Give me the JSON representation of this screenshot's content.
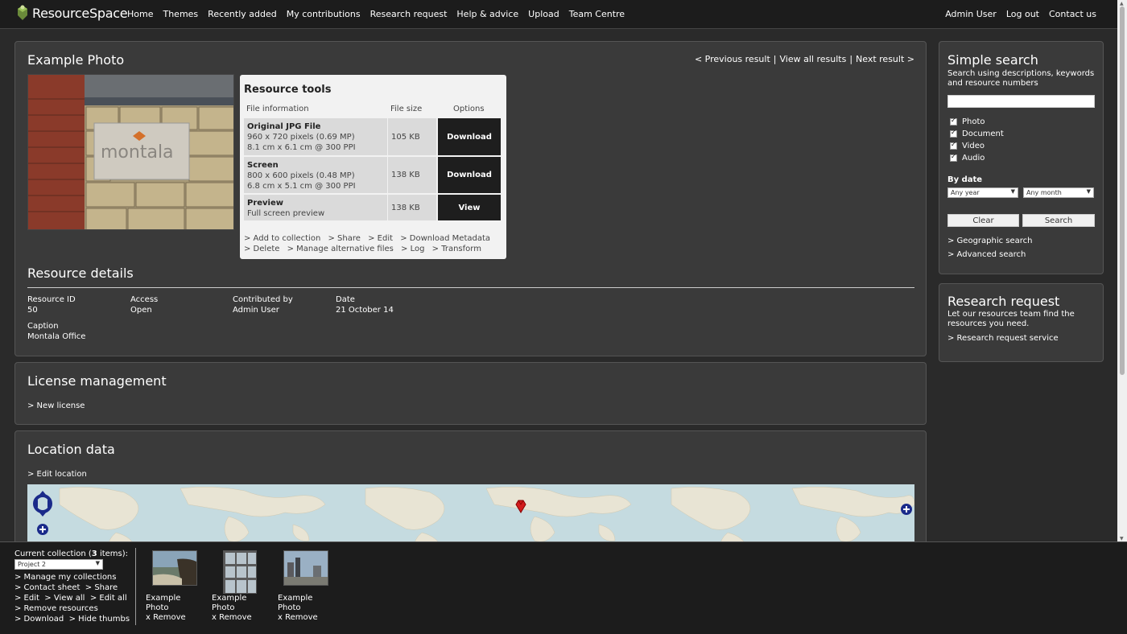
{
  "header": {
    "logo_text": "ResourceSpace",
    "nav": [
      "Home",
      "Themes",
      "Recently added",
      "My contributions",
      "Research request",
      "Help & advice",
      "Upload",
      "Team Centre"
    ],
    "user_nav": [
      "Admin User",
      "Log out",
      "Contact us"
    ]
  },
  "resource": {
    "title": "Example Photo",
    "result_nav": {
      "previous": "< Previous result",
      "view_all": "View all results",
      "next": "Next result >",
      "separator": "|"
    },
    "image_sign_text": "montala",
    "tools": {
      "title": "Resource tools",
      "columns": [
        "File information",
        "File size",
        "Options"
      ],
      "rows": [
        {
          "name": "Original JPG File",
          "line1": "960 x 720 pixels (0.69 MP)",
          "line2": "8.1 cm x 6.1 cm @ 300 PPI",
          "size": "105 KB",
          "action": "Download"
        },
        {
          "name": "Screen",
          "line1": "800 x 600 pixels (0.48 MP)",
          "line2": "6.8 cm x 5.1 cm @ 300 PPI",
          "size": "138 KB",
          "action": "Download"
        },
        {
          "name": "Preview",
          "line1": "Full screen preview",
          "line2": "",
          "size": "138 KB",
          "action": "View"
        }
      ],
      "links_line1": [
        "> Add to collection",
        "> Share",
        "> Edit",
        "> Download Metadata"
      ],
      "links_line2": [
        "> Delete",
        "> Manage alternative files",
        "> Log",
        "> Transform"
      ]
    },
    "details": {
      "title": "Resource details",
      "fields": [
        {
          "label": "Resource ID",
          "value": "50"
        },
        {
          "label": "Access",
          "value": "Open"
        },
        {
          "label": "Contributed by",
          "value": "Admin User"
        },
        {
          "label": "Date",
          "value": "21 October 14"
        },
        {
          "label": "Caption",
          "value": "Montala Office"
        }
      ]
    }
  },
  "license": {
    "title": "License management",
    "new_link": "> New license"
  },
  "location": {
    "title": "Location data",
    "edit_link": "> Edit location"
  },
  "search": {
    "title": "Simple search",
    "description": "Search using descriptions, keywords and resource numbers",
    "input_value": "",
    "filters": [
      "Photo",
      "Document",
      "Video",
      "Audio"
    ],
    "by_date_label": "By date",
    "year_select": "Any year",
    "month_select": "Any month",
    "clear_label": "Clear",
    "search_label": "Search",
    "geo_link": "> Geographic search",
    "advanced_link": "> Advanced search"
  },
  "research": {
    "title": "Research request",
    "description": "Let our resources team find the resources you need.",
    "link": "> Research request service"
  },
  "collection": {
    "label_prefix": "Current collection (",
    "count": "3",
    "label_suffix": " items):",
    "selected": "Project 2",
    "links": [
      [
        "> Manage my collections"
      ],
      [
        "> Contact sheet",
        "> Share"
      ],
      [
        "> Edit",
        "> View all",
        "> Edit all"
      ],
      [
        "> Remove resources"
      ],
      [
        "> Download",
        "> Hide thumbs"
      ]
    ],
    "items": [
      {
        "title_line1": "Example",
        "title_line2": "Photo",
        "remove": "x Remove"
      },
      {
        "title_line1": "Example",
        "title_line2": "Photo",
        "remove": "x Remove"
      },
      {
        "title_line1": "Example",
        "title_line2": "Photo",
        "remove": "x Remove"
      }
    ]
  }
}
